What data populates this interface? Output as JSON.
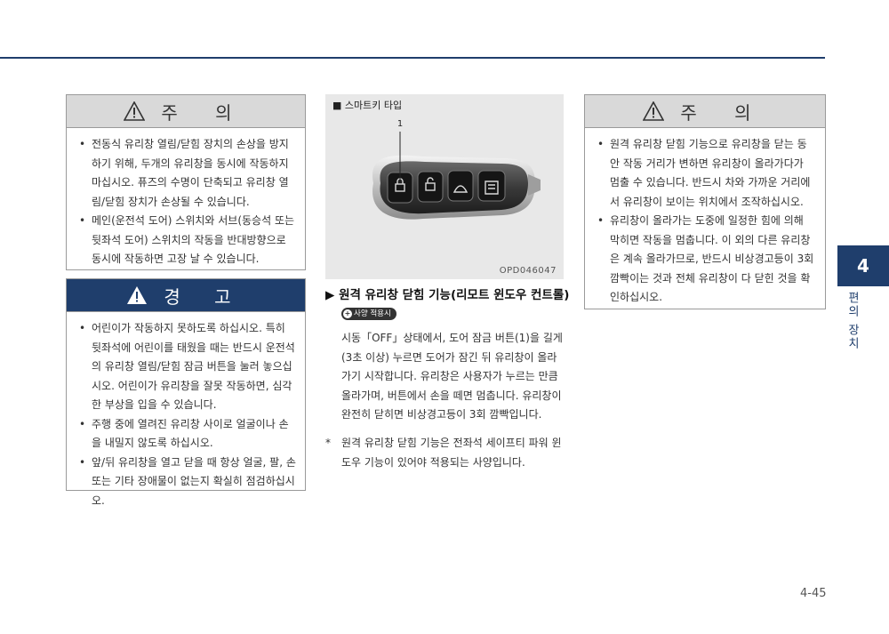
{
  "caution_left": {
    "title": "주 의",
    "items": [
      "전동식 유리창 열림/닫힘 장치의 손상을 방지하기 위해, 두개의 유리창을 동시에 작동하지 마십시오. 퓨즈의 수명이 단축되고 유리창 열림/닫힘 장치가 손상될 수 있습니다.",
      "메인(운전석 도어) 스위치와 서브(동승석 또는 뒷좌석 도어) 스위치의 작동을 반대방향으로 동시에 작동하면 고장 날 수 있습니다."
    ]
  },
  "warning": {
    "title": "경 고",
    "items": [
      "어린이가 작동하지 못하도록 하십시오. 특히 뒷좌석에 어린이를 태웠을 때는 반드시 운전석의 유리창 열림/닫힘 잠금 버튼을 눌러 놓으십시오. 어린이가 유리창을 잘못 작동하면, 심각한 부상을 입을 수 있습니다.",
      "주행 중에 열려진 유리창 사이로 얼굴이나 손을 내밀지 않도록 하십시오.",
      "앞/뒤 유리창을 열고 닫을 때 항상 얼굴, 팔, 손 또는 기타 장애물이 없는지 확실히 점검하십시오."
    ]
  },
  "figure": {
    "caption": "■ 스마트키 타입",
    "callout": "1",
    "code": "OPD046047"
  },
  "section": {
    "title": "▶ 원격 유리창 닫힘 기능(리모트 윈도우 컨트롤)",
    "badge": "사양 적용시",
    "body": "시동「OFF」상태에서, 도어 잠금 버튼(1)을 길게 (3초 이상) 누르면 도어가 잠긴 뒤 유리창이 올라가기 시작합니다. 유리창은 사용자가 누르는 만큼 올라가며, 버튼에서 손을 떼면 멈춥니다. 유리창이 완전히 닫히면 비상경고등이 3회 깜빡입니다.",
    "note_mark": "*",
    "note": "원격 유리창 닫힘 기능은 전좌석 세이프티 파워 윈도우 기능이 있어야 적용되는 사양입니다."
  },
  "caution_right": {
    "title": "주 의",
    "items": [
      "원격 유리창 닫힘 기능으로 유리창을 닫는 동안 작동 거리가 변하면 유리창이 올라가다가 멈출 수 있습니다. 반드시 차와 가까운 거리에서 유리창이 보이는 위치에서 조작하십시오.",
      "유리창이 올라가는 도중에 일정한 힘에 의해 막히면 작동을 멈춥니다. 이 외의 다른 유리창은 계속 올라가므로, 반드시 비상경고등이 3회 깜빡이는 것과 전체 유리창이 다 닫힌 것을 확인하십시오."
    ]
  },
  "chapter": {
    "number": "4",
    "label": "편의 장치"
  },
  "page_number": "4-45"
}
